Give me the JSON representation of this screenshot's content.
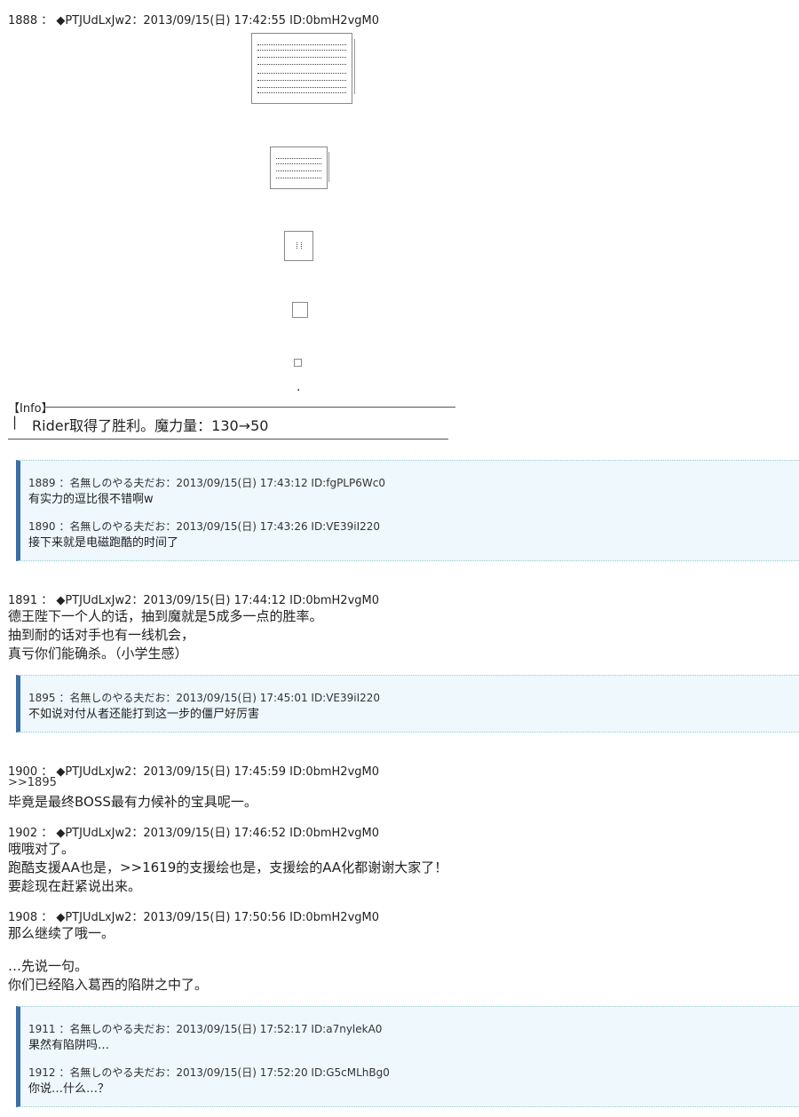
{
  "posts": [
    {
      "header": "1888 ： ◆PTJUdLxJw2：2013/09/15(日) 17:42:55 ID:0bmH2vgM0"
    },
    {
      "header": "1891 ： ◆PTJUdLxJw2：2013/09/15(日) 17:44:12 ID:0bmH2vgM0",
      "lines": [
        "德王陛下一个人的话，抽到魔就是5成多一点的胜率。",
        "抽到耐的话对手也有一线机会，",
        "真亏你们能确杀。（小学生感）"
      ]
    },
    {
      "header": "1900 ： ◆PTJUdLxJw2：2013/09/15(日) 17:45:59 ID:0bmH2vgM0",
      "lines": [
        ">>1895",
        "毕竟是最终BOSS最有力候补的宝具呢一。"
      ]
    },
    {
      "header": "1902 ： ◆PTJUdLxJw2：2013/09/15(日) 17:46:52 ID:0bmH2vgM0",
      "lines": [
        "哦哦对了。",
        "跑酷支援AA也是，>>1619的支援绘也是，支援绘的AA化都谢谢大家了！",
        "要趁现在赶紧说出来。"
      ]
    },
    {
      "header": "1908 ： ◆PTJUdLxJw2：2013/09/15(日) 17:50:56 ID:0bmH2vgM0",
      "lines": [
        "那么继续了哦一。",
        "…先说一句。",
        "你们已经陷入葛西的陷阱之中了。"
      ]
    }
  ],
  "info": {
    "title": "【Info】",
    "bar": "|",
    "text": "Rider取得了胜利。魔力量：130→50",
    "dot": "."
  },
  "boxes": [
    {
      "items": [
        {
          "header": "1889 ：名無しのやる夫だお：2013/09/15(日) 17:43:12 ID:fgPLP6Wc0",
          "text": "有实力的逗比很不错啊w"
        },
        {
          "header": "1890 ：名無しのやる夫だお：2013/09/15(日) 17:43:26 ID:VE39iI220",
          "text": "接下来就是电磁跑酷的时间了"
        }
      ]
    },
    {
      "items": [
        {
          "header": "1895 ：名無しのやる夫だお：2013/09/15(日) 17:45:01 ID:VE39iI220",
          "text": "不如说对付从者还能打到这一步的僵尸好厉害"
        }
      ]
    },
    {
      "items": [
        {
          "header": "1911 ：名無しのやる夫だお：2013/09/15(日) 17:52:17 ID:a7nylekA0",
          "text": "果然有陷阱吗…"
        },
        {
          "header": "1912 ：名無しのやる夫だお：2013/09/15(日) 17:52:20 ID:G5cMLhBg0",
          "text": "你说…什么…？"
        }
      ]
    }
  ]
}
